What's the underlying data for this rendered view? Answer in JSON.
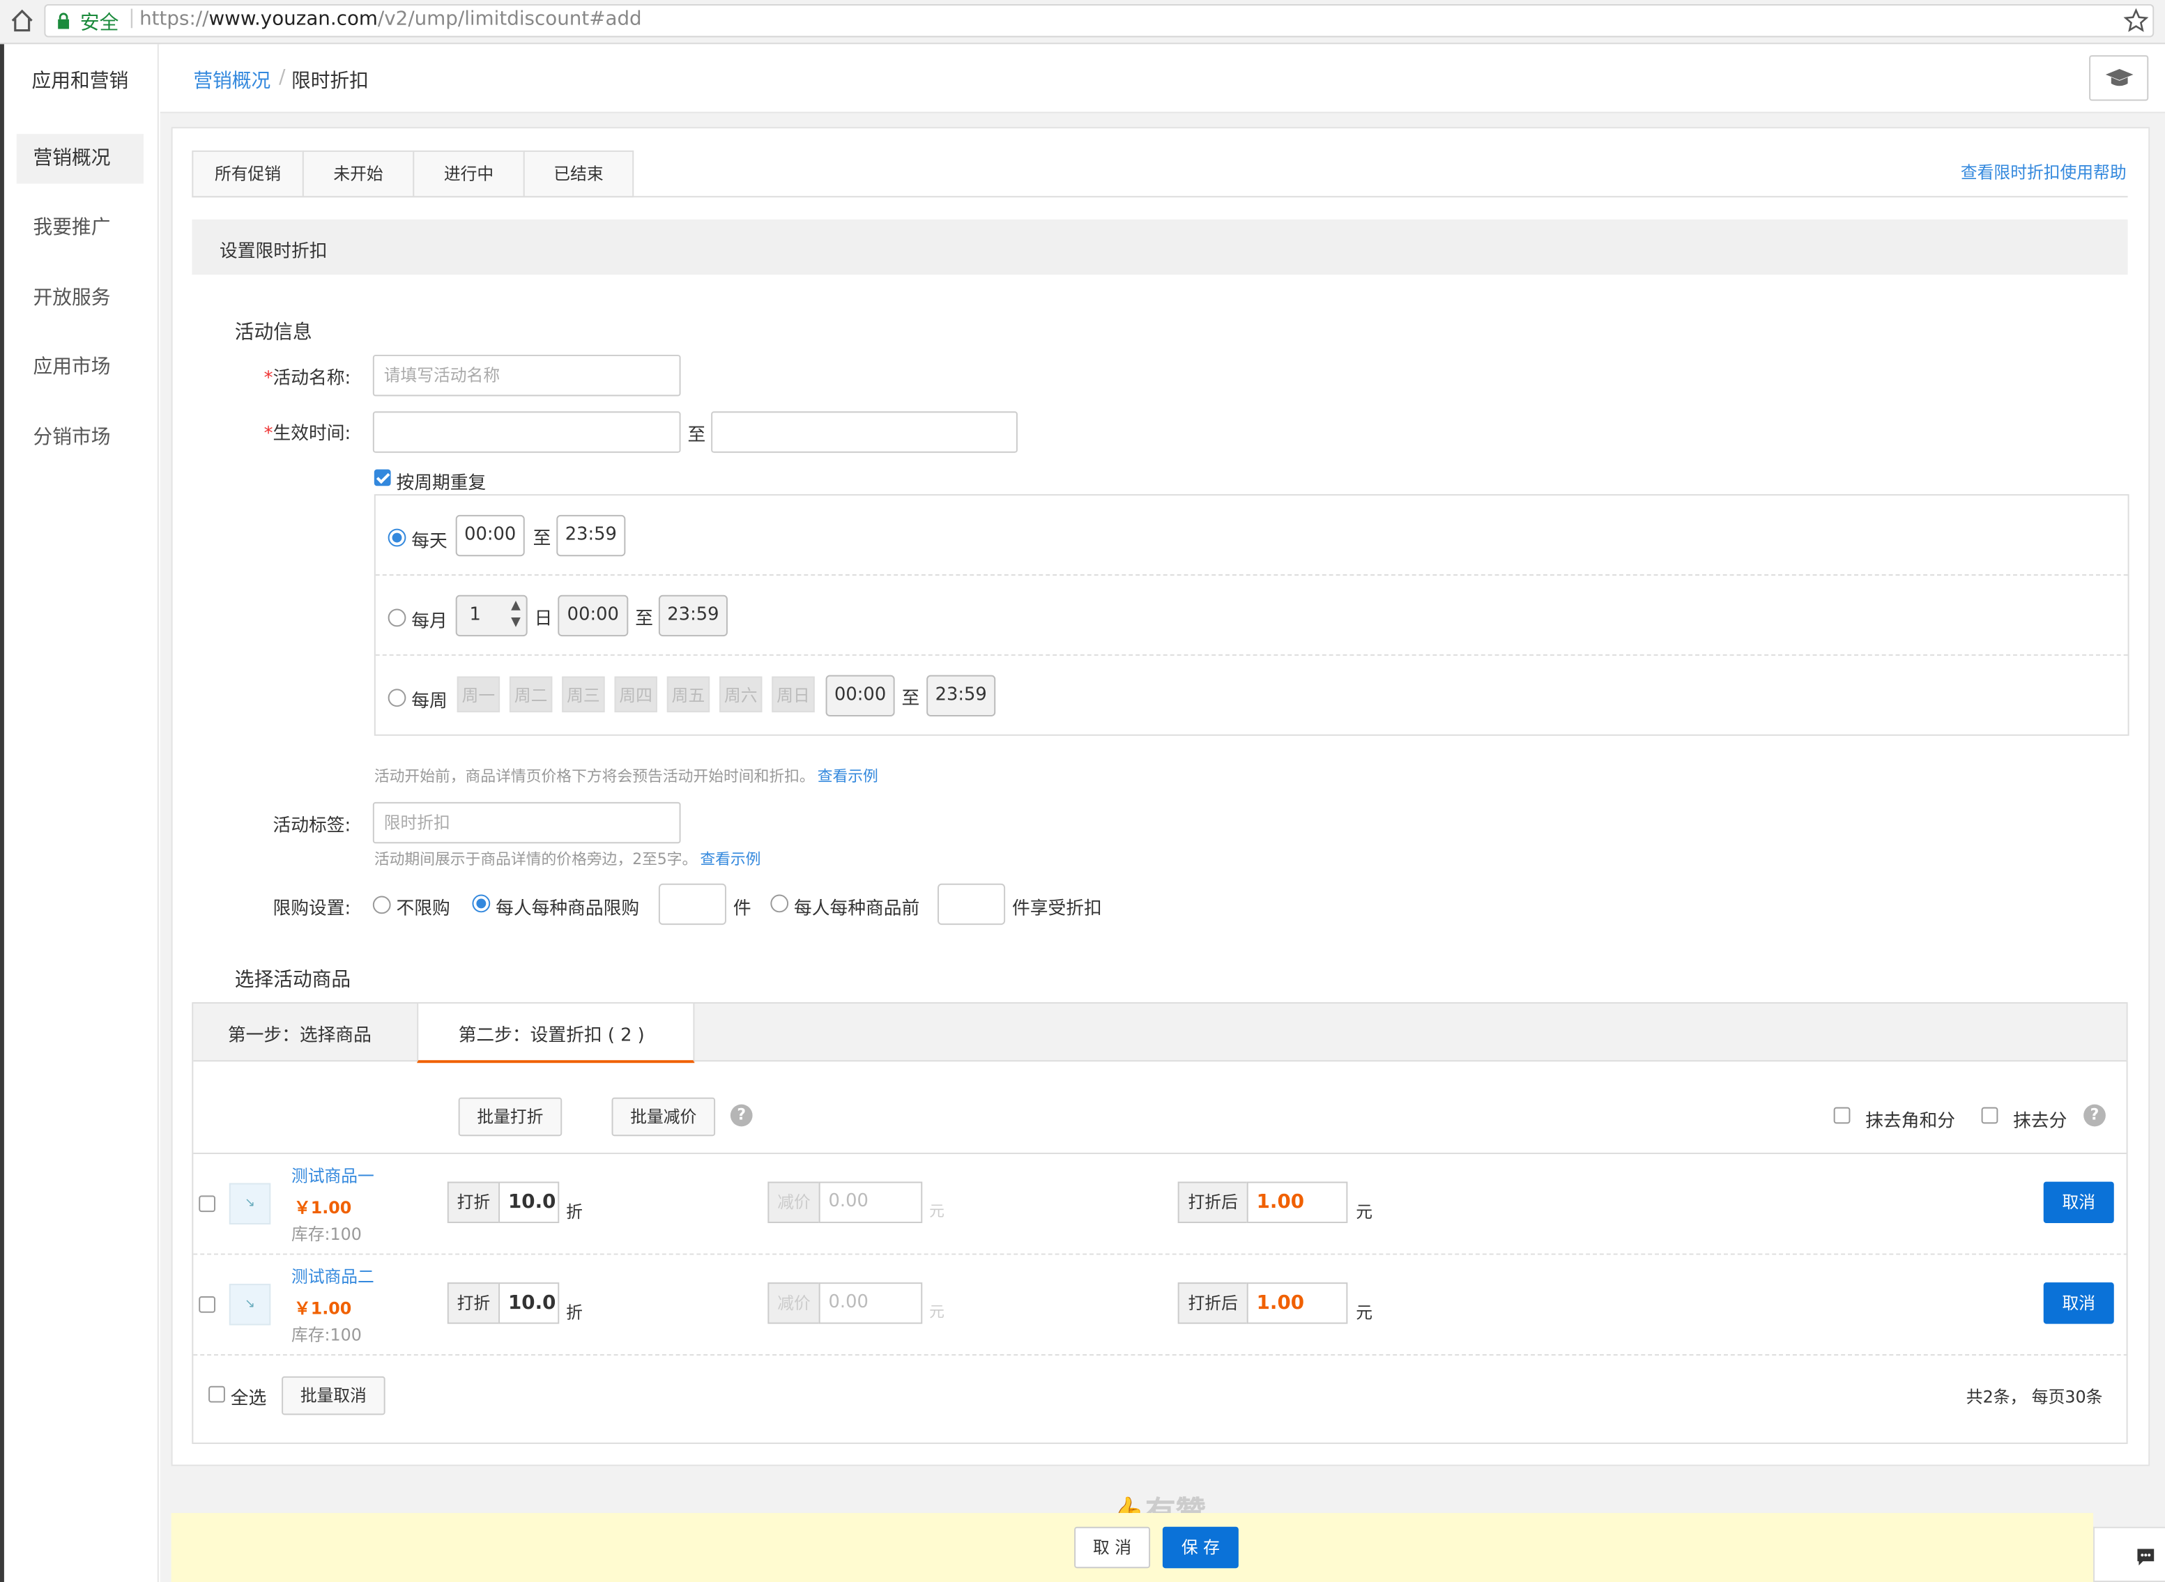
{
  "browser": {
    "secure_label": "安全",
    "url_domain_prefix": "https://",
    "url_domain": "www.youzan.com",
    "url_path": "/v2/ump/limitdiscount#add"
  },
  "sidebar": {
    "title": "应用和营销",
    "items": [
      {
        "label": "营销概况",
        "active": true
      },
      {
        "label": "我要推广"
      },
      {
        "label": "开放服务"
      },
      {
        "label": "应用市场"
      },
      {
        "label": "分销市场"
      }
    ]
  },
  "breadcrumb": {
    "parent": "营销概况",
    "separator": "/",
    "current": "限时折扣"
  },
  "tabs": [
    "所有促销",
    "未开始",
    "进行中",
    "已结束"
  ],
  "help_link": "查看限时折扣使用帮助",
  "section_title": "设置限时折扣",
  "activity_info": {
    "heading": "活动信息",
    "name_label": "活动名称:",
    "name_placeholder": "请填写活动名称",
    "time_label": "生效时间:",
    "to": "至",
    "repeat_label": "按周期重复",
    "daily": {
      "label": "每天",
      "start": "00:00",
      "end": "23:59"
    },
    "monthly": {
      "label": "每月",
      "day": "1",
      "day_unit": "日",
      "start": "00:00",
      "end": "23:59"
    },
    "weekly": {
      "label": "每周",
      "days": [
        "周一",
        "周二",
        "周三",
        "周四",
        "周五",
        "周六",
        "周日"
      ],
      "start": "00:00",
      "end": "23:59"
    },
    "preview_hint": "活动开始前，商品详情页价格下方将会预告活动开始时间和折扣。",
    "view_example": "查看示例",
    "tag_label": "活动标签:",
    "tag_placeholder": "限时折扣",
    "tag_hint": "活动期间展示于商品详情的价格旁边，2至5字。",
    "limit_label": "限购设置:",
    "limit_none": "不限购",
    "limit_each": "每人每种商品限购",
    "limit_unit": "件",
    "limit_first": "每人每种商品前",
    "limit_first_suffix": "件享受折扣"
  },
  "goods": {
    "heading": "选择活动商品",
    "step1": "第一步：选择商品",
    "step2": "第二步：设置折扣 ( 2 )",
    "batch_discount": "批量打折",
    "batch_reduce": "批量减价",
    "round_jiao_fen": "抹去角和分",
    "round_fen": "抹去分",
    "rows": [
      {
        "name": "测试商品一",
        "price": "￥1.00",
        "stock": "库存:100",
        "discount_label": "打折",
        "discount": "10.0",
        "discount_unit": "折",
        "reduce_label": "减价",
        "reduce": "0.00",
        "reduce_unit": "元",
        "after_label": "打折后",
        "after": "1.00",
        "after_unit": "元",
        "cancel": "取消"
      },
      {
        "name": "测试商品二",
        "price": "￥1.00",
        "stock": "库存:100",
        "discount_label": "打折",
        "discount": "10.0",
        "discount_unit": "折",
        "reduce_label": "减价",
        "reduce": "0.00",
        "reduce_unit": "元",
        "after_label": "打折后",
        "after": "1.00",
        "after_unit": "元",
        "cancel": "取消"
      }
    ],
    "select_all": "全选",
    "batch_cancel": "批量取消",
    "summary": "共2条， 每页30条"
  },
  "footer": {
    "watermark": "有赞",
    "cancel": "取 消",
    "save": "保 存"
  },
  "colors": {
    "accent": "#3388dd",
    "primary_button": "#0b72d8",
    "price": "#f06000",
    "footer_bg": "#fffbd0"
  }
}
